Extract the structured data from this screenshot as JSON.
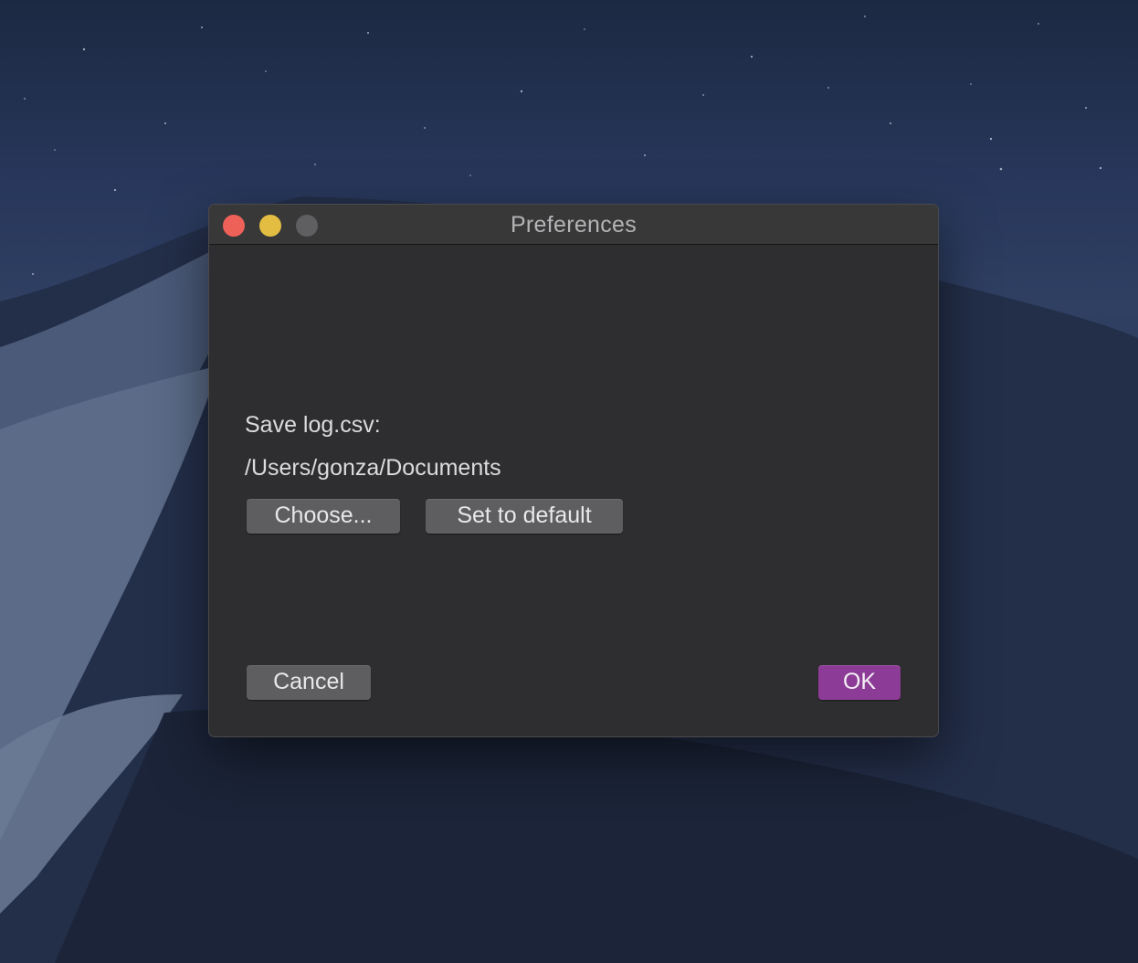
{
  "window": {
    "title": "Preferences"
  },
  "preferences": {
    "save_label": "Save log.csv:",
    "save_path": "/Users/gonza/Documents",
    "choose_button": "Choose...",
    "set_default_button": "Set to default"
  },
  "footer": {
    "cancel_button": "Cancel",
    "ok_button": "OK"
  },
  "colors": {
    "close": "#ee6159",
    "minimize": "#e3bd42",
    "zoom": "#5f5f61",
    "window_bg": "#2e2e30",
    "button_bg": "#5e5e60",
    "ok_accent": "#8c3c96"
  }
}
